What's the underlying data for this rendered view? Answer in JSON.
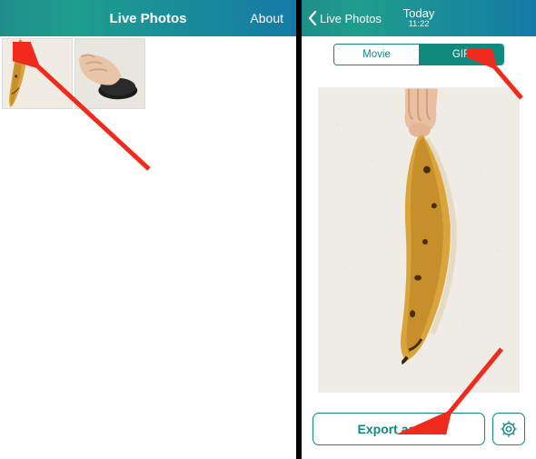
{
  "left": {
    "app_title": "Live Photos",
    "about_label": "About",
    "thumbnails": [
      {
        "name": "thumb-banana"
      },
      {
        "name": "thumb-hand-remote"
      }
    ]
  },
  "right": {
    "back_label": "Live Photos",
    "header_title": "Today",
    "header_time": "11:22",
    "segments": {
      "movie": "Movie",
      "gif": "GIF"
    },
    "export_label": "Export as GIF"
  },
  "colors": {
    "accent": "#108a7d",
    "header_grad_a": "#1f8e8a",
    "header_grad_b": "#147aa5",
    "arrow": "#f02a1d"
  }
}
